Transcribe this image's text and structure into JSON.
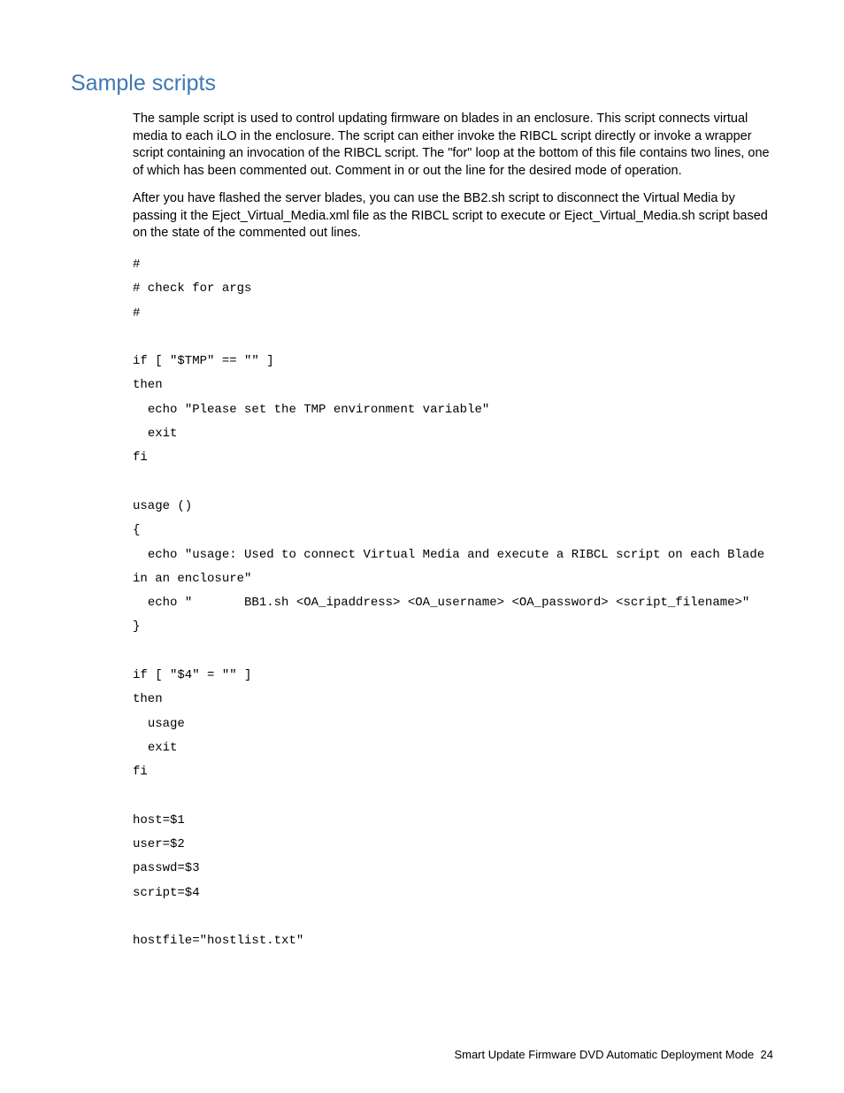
{
  "heading": "Sample scripts",
  "paragraphs": [
    "The sample script is used to control updating firmware on blades in an enclosure. This script connects virtual media to each iLO in the enclosure. The script can either invoke the RIBCL script directly or invoke a wrapper script containing an invocation of the RIBCL script. The \"for\" loop at the bottom of this file contains two lines, one of which has been commented out. Comment in or out the line for the desired mode of operation.",
    "After you have flashed the server blades, you can use the BB2.sh script to disconnect the Virtual Media by passing it the Eject_Virtual_Media.xml file as the RIBCL script to execute or Eject_Virtual_Media.sh script based on the state of the commented out lines."
  ],
  "code": "#\n# check for args\n#\n\nif [ \"$TMP\" == \"\" ]\nthen\n  echo \"Please set the TMP environment variable\"\n  exit\nfi\n\nusage ()\n{\n  echo \"usage: Used to connect Virtual Media and execute a RIBCL script on each Blade in an enclosure\"\n  echo \"       BB1.sh <OA_ipaddress> <OA_username> <OA_password> <script_filename>\"\n}\n\nif [ \"$4\" = \"\" ]\nthen\n  usage\n  exit\nfi\n\nhost=$1\nuser=$2\npasswd=$3\nscript=$4\n\nhostfile=\"hostlist.txt\"",
  "footer": {
    "text": "Smart Update Firmware DVD Automatic Deployment Mode",
    "page": "24"
  }
}
